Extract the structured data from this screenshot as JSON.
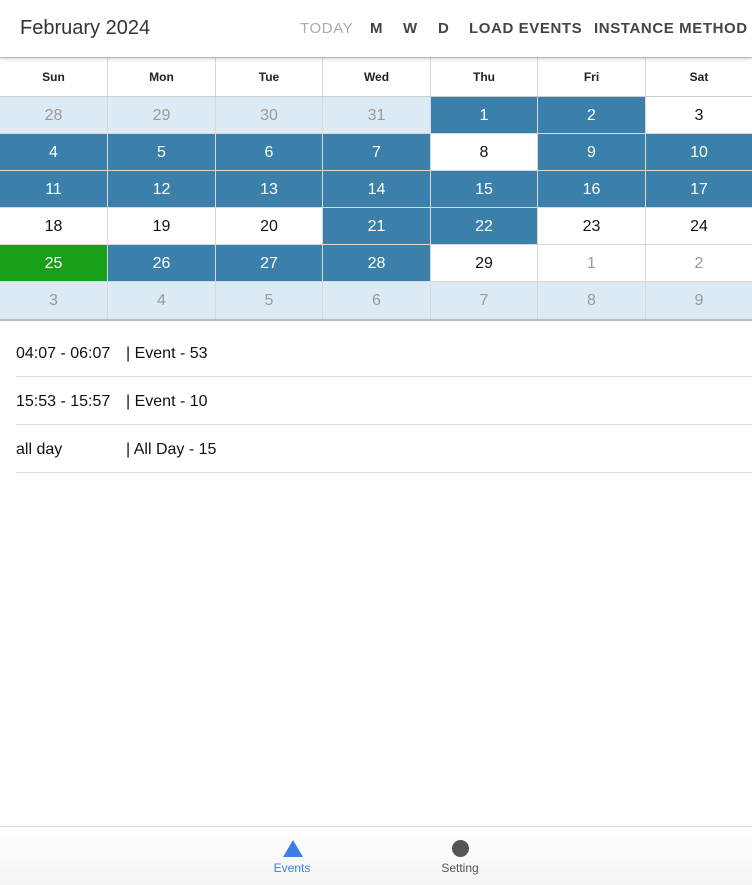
{
  "header": {
    "title": "February 2024",
    "buttons": {
      "today": "TODAY",
      "month": "M",
      "week": "W",
      "day": "D",
      "load": "LOAD EVENTS",
      "instance": "INSTANCE METHOD"
    }
  },
  "calendar": {
    "weekdays": [
      "Sun",
      "Mon",
      "Tue",
      "Wed",
      "Thu",
      "Fri",
      "Sat"
    ],
    "weeks": [
      [
        "28",
        "29",
        "30",
        "31",
        "1",
        "2",
        "3"
      ],
      [
        "4",
        "5",
        "6",
        "7",
        "8",
        "9",
        "10"
      ],
      [
        "11",
        "12",
        "13",
        "14",
        "15",
        "16",
        "17"
      ],
      [
        "18",
        "19",
        "20",
        "21",
        "22",
        "23",
        "24"
      ],
      [
        "25",
        "26",
        "27",
        "28",
        "29",
        "1",
        "2"
      ],
      [
        "3",
        "4",
        "5",
        "6",
        "7",
        "8",
        "9"
      ]
    ],
    "selected_date": "25",
    "colors": {
      "event_day": "#3a80aa",
      "selected_day": "#18a01a",
      "outside_month": "#dbeaf4"
    }
  },
  "events": [
    {
      "time": "04:07 - 06:07",
      "name": "| Event - 53"
    },
    {
      "time": "15:53 - 15:57",
      "name": "| Event - 10"
    },
    {
      "time": "all day",
      "name": "| All Day - 15"
    }
  ],
  "tabs": [
    {
      "label": "Events",
      "icon": "triangle-icon",
      "active": true
    },
    {
      "label": "Setting",
      "icon": "circle-icon",
      "active": false
    }
  ]
}
